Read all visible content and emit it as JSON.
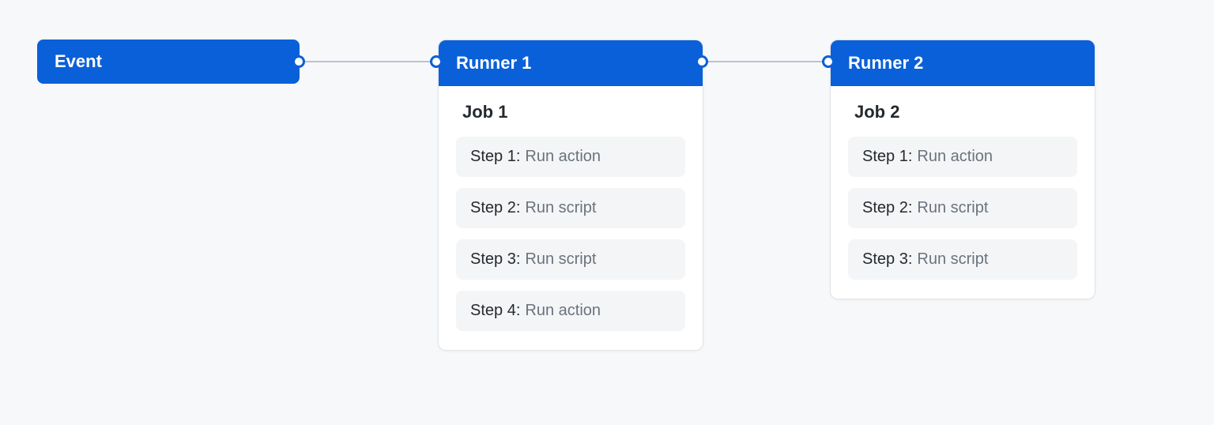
{
  "event": {
    "label": "Event"
  },
  "runners": [
    {
      "header": "Runner 1",
      "job_title": "Job 1",
      "steps": [
        {
          "label": "Step 1:",
          "desc": "Run action"
        },
        {
          "label": "Step 2:",
          "desc": "Run script"
        },
        {
          "label": "Step 3:",
          "desc": "Run script"
        },
        {
          "label": "Step 4:",
          "desc": "Run action"
        }
      ]
    },
    {
      "header": "Runner 2",
      "job_title": "Job 2",
      "steps": [
        {
          "label": "Step 1:",
          "desc": "Run action"
        },
        {
          "label": "Step 2:",
          "desc": "Run script"
        },
        {
          "label": "Step 3:",
          "desc": "Run script"
        }
      ]
    }
  ]
}
